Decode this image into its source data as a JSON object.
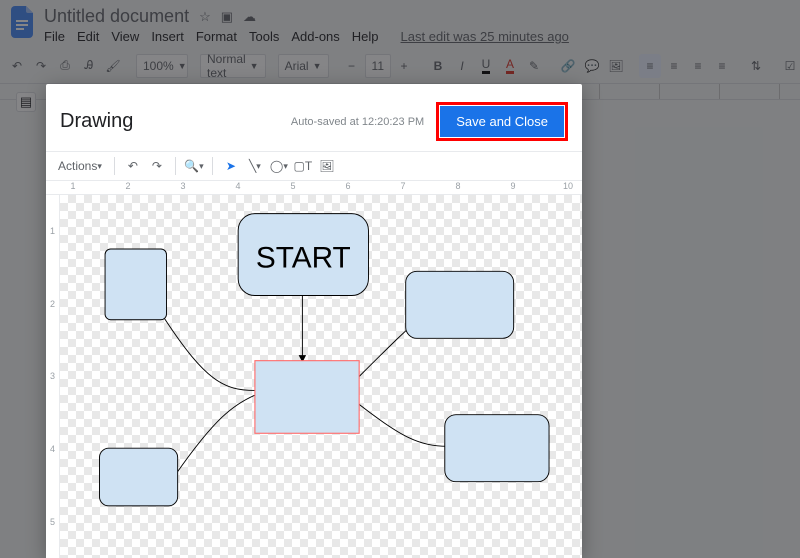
{
  "header": {
    "doc_title": "Untitled document",
    "menus": [
      "File",
      "Edit",
      "View",
      "Insert",
      "Format",
      "Tools",
      "Add-ons",
      "Help"
    ],
    "last_edit": "Last edit was 25 minutes ago"
  },
  "toolbar": {
    "zoom": "100%",
    "style": "Normal text",
    "font": "Arial",
    "font_size": "11"
  },
  "drawing": {
    "title": "Drawing",
    "autosave": "Auto-saved at 12:20:23 PM",
    "save_label": "Save and Close",
    "actions_label": "Actions",
    "ruler_top": [
      "1",
      "2",
      "3",
      "4",
      "5",
      "6",
      "7",
      "8",
      "9",
      "10"
    ],
    "ruler_left": [
      "1",
      "2",
      "3",
      "4",
      "5"
    ],
    "canvas": {
      "start_label": "START"
    }
  }
}
